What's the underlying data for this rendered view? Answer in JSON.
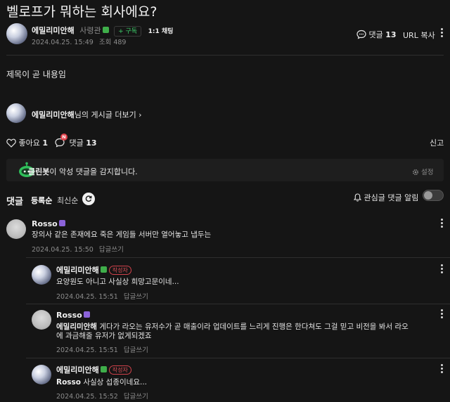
{
  "post": {
    "title": "벨로프가 뭐하는 회사에요?",
    "author": "에밀리미안해",
    "author_rank": "사령관",
    "subscribe_label": "+ 구독",
    "chat_label": "1:1 채팅",
    "date": "2024.04.25. 15:49",
    "views_label": "조회 489",
    "comment_label": "댓글",
    "comment_count": "13",
    "url_copy_label": "URL 복사",
    "body": "제목이 곧 내용임",
    "more_posts_author": "에밀리미안해",
    "more_posts_label": "님의 게시글 더보기 ›"
  },
  "actions": {
    "like_label": "좋아요",
    "like_count": "1",
    "comment_label": "댓글",
    "comment_count": "13",
    "new_badge": "N",
    "report_label": "신고"
  },
  "cleanbot": {
    "name": "클린봇",
    "message": "이 악성 댓글을 감지합니다.",
    "settings_label": "설정"
  },
  "comments_header": {
    "title": "댓글",
    "sort_registered": "등록순",
    "sort_latest": "최신순",
    "notify_label": "관심글 댓글 알림"
  },
  "comments": [
    {
      "author": "Rosso",
      "text": "장의사 같은 존재에요 죽은 게임들 서버만 열어놓고 냅두는",
      "date": "2024.04.25. 15:50",
      "reply_label": "답글쓰기"
    },
    {
      "author": "에밀리미안해",
      "writer_badge": "작성자",
      "text": "요양원도 아니고 사실상 희망고문이네...",
      "date": "2024.04.25. 15:51",
      "reply_label": "답글쓰기"
    },
    {
      "author": "Rosso",
      "mention": "에밀리미안해",
      "text_line1": "게다가 라오는 유저수가 곧 매출이라 업데이트를 느리게 진행은 한다쳐도 그걸 믿고 비전을 봐서 라오",
      "text_line2": "에 과금해줄 유저가 없게되겠죠",
      "date": "2024.04.25. 15:51",
      "reply_label": "답글쓰기"
    },
    {
      "author": "에밀리미안해",
      "writer_badge": "작성자",
      "mention": "Rosso",
      "text": "사실상 섭종이네요...",
      "date": "2024.04.25. 15:52",
      "reply_label": "답글쓰기"
    }
  ],
  "colors": {
    "background": "#151515",
    "accent_green": "#3fd06b",
    "writer_red": "#e04f58",
    "level_green": "#3fae4a",
    "level_purple": "#8b63d9"
  },
  "icons": [
    "comment-bubble-icon",
    "heart-icon",
    "speech-bubble-icon",
    "gear-icon",
    "bell-icon",
    "refresh-icon",
    "kebab-menu-icon",
    "cleanbot-icon"
  ]
}
